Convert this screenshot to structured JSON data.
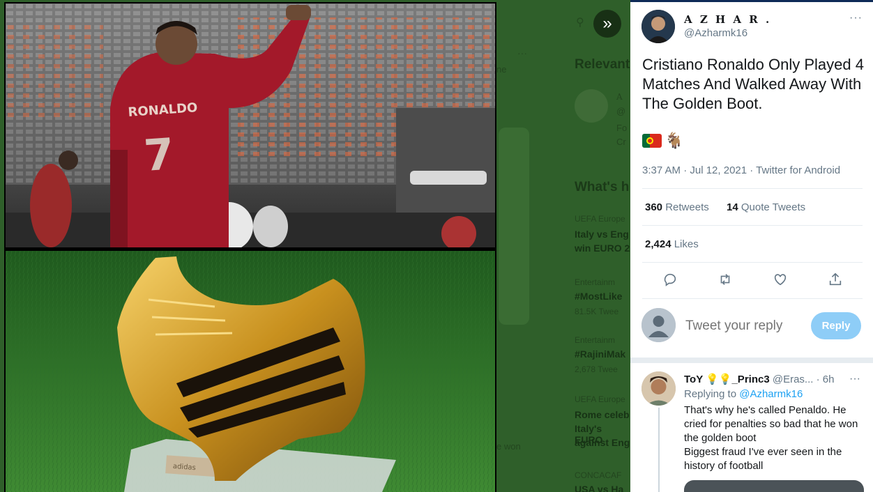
{
  "backdrop": {
    "section_relevant": "Relevant",
    "section_happening": "What's h",
    "relevant_name": "A",
    "relevant_handle": "@",
    "relevant_line1": "Fo",
    "relevant_line2": "Cr",
    "trends": [
      {
        "head": "UEFA Europe",
        "title1": "Italy vs Eng",
        "title2": "win EURO 2",
        "count": ""
      },
      {
        "head": "Entertainm",
        "title1": "#MostLike",
        "title2": "",
        "count": "81.5K Twee"
      },
      {
        "head": "Entertainm",
        "title1": "#RajiniMak",
        "title2": "",
        "count": "2,678 Twee"
      },
      {
        "head": "UEFA Europe",
        "title1": "Rome celeb",
        "title2": "Italy's EURO",
        "title3": "against Eng",
        "count": ""
      },
      {
        "head": "CONCACAF",
        "title1": "USA vs Ha",
        "title2": "",
        "count": ""
      }
    ],
    "left_snippet_1": "ne",
    "left_snippet_2": "e won"
  },
  "media": {
    "top_image_alt": "Ronaldo 7 celebrating in stadium",
    "bottom_image_alt": "Golden boot trophy on grass",
    "jersey_name": "RONALDO",
    "jersey_number": "7",
    "plaque_text": "adidas",
    "expand_icon": "»"
  },
  "tweet": {
    "author_name": "A Z H A R .",
    "author_handle": "@Azharmk16",
    "text": "Cristiano Ronaldo Only Played 4 Matches And Walked Away With The Golden Boot.",
    "emoji_goat": "🐐",
    "meta": "3:37 AM · Jul 12, 2021 · Twitter for Android",
    "retweets_count": "360",
    "retweets_label": "Retweets",
    "quotes_count": "14",
    "quotes_label": "Quote Tweets",
    "likes_count": "2,424",
    "likes_label": "Likes",
    "more": "···"
  },
  "reply_box": {
    "placeholder": "Tweet your reply",
    "button_label": "Reply"
  },
  "reply": {
    "name": "ToY 💡💡_Princ3",
    "handle": "@Eras...",
    "time": "· 6h",
    "replying_prefix": "Replying to",
    "replying_to": "@Azharmk16",
    "text": "That's why he's called Penaldo. He cried for penalties so bad that he won the golden boot\nBiggest fraud I've ever seen in the history of football",
    "more": "···"
  },
  "colors": {
    "accent": "#1da1f2",
    "reply_button_disabled": "#8ecdf7",
    "text_secondary": "#657786"
  },
  "icons": [
    "expand-icon",
    "more-icon",
    "reply-icon",
    "retweet-icon",
    "like-icon",
    "share-icon",
    "default-avatar-icon"
  ]
}
